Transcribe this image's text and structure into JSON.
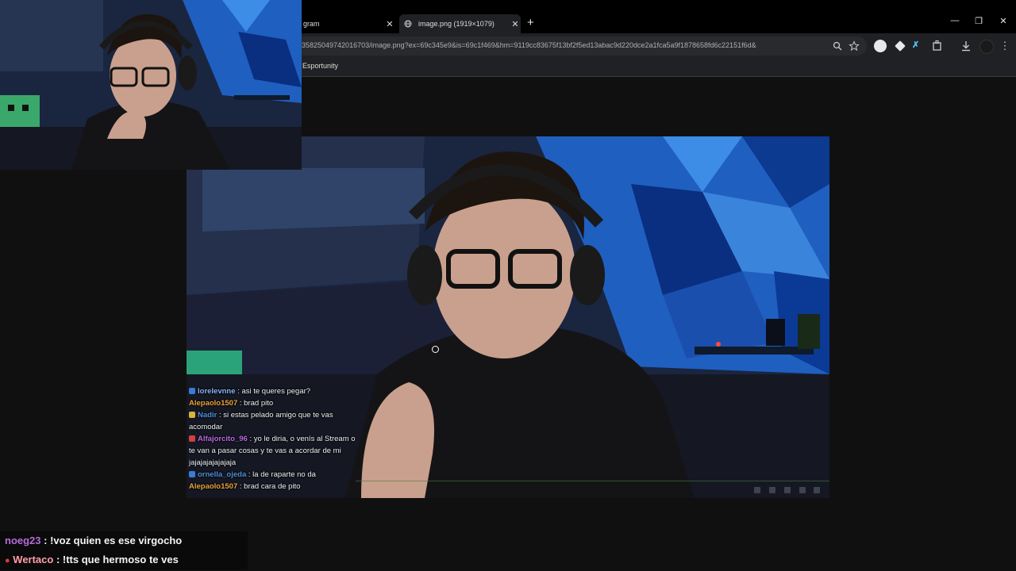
{
  "browser": {
    "tabs": [
      {
        "title": "gram",
        "active": false
      },
      {
        "title": "image.png (1919×1079)",
        "active": true
      }
    ],
    "new_tab_icon": "plus-icon",
    "window_controls": {
      "minimize": "—",
      "restore": "❐",
      "close": "✕"
    },
    "tab_close": "✕",
    "address": "35825049742016703/image.png?ex=69c345e9&is=69c1f469&hm=9119cc83675f13bf2f5ed13abac9d220dce2a1fca5a9f1878658fd6c22151f6d&",
    "bookmark": "Esportunity",
    "icons": [
      "zoom-icon",
      "star-icon",
      "extension-icon",
      "download-icon",
      "profile-icon",
      "menu-icon"
    ]
  },
  "stream_chat": [
    {
      "user": "lorelevnne",
      "text": ": asi te queres pegar?",
      "color": "#8ab4f8"
    },
    {
      "user": "Alepaolo1507",
      "text": ": brad pito",
      "color": "#e8a33a"
    },
    {
      "user": "Nadir",
      "text": ": si estas pelado amigo que te vas acomodar",
      "color": "#4f8fd6"
    },
    {
      "user": "Alfajorcito_96",
      "text": ": yo le diria, o venís al Stream o te van a pasar cosas y te vas a acordar de mi jajajajajajajaja",
      "color": "#b86bdc"
    },
    {
      "user": "ornella_ojeda",
      "text": ": la de raparte no da",
      "color": "#4f8fd6"
    },
    {
      "user": "Alepaolo1507",
      "text": ": brad cara de pito",
      "color": "#e8a33a"
    }
  ],
  "overlay_chat": [
    {
      "user": "noeg23",
      "text": " : !voz quien es ese virgocho",
      "color": "#b86bdc",
      "badge": false
    },
    {
      "user": "Wertaco",
      "text": " : !tts que hermoso te ves",
      "color": "#ff9fa8",
      "badge": true
    }
  ]
}
